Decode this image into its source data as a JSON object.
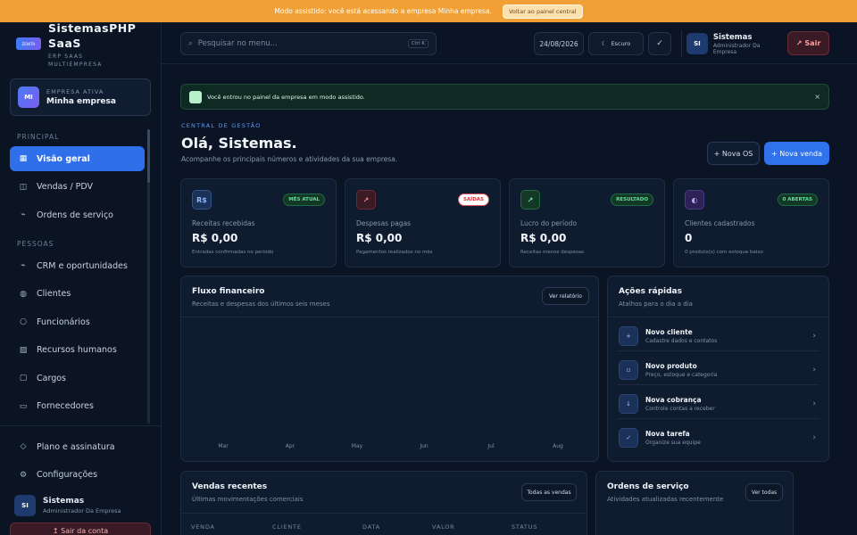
{
  "banner": {
    "text": "Modo assistido: você está acessando a empresa Minha empresa.",
    "button": "Voltar ao painel central"
  },
  "brand": {
    "logo_text": "ZENITH",
    "line1": "SistemasPHP",
    "line2": "SaaS",
    "sub1": "ERP SAAS",
    "sub2": "MULTIEMPRESA"
  },
  "company": {
    "initials": "MI",
    "label": "EMPRESA ATIVA",
    "name": "Minha empresa"
  },
  "sidebar": {
    "section_principal": "PRINCIPAL",
    "section_pessoas": "PESSOAS",
    "items": [
      {
        "label": "Visão geral",
        "icon": "grid-icon"
      },
      {
        "label": "Vendas / PDV",
        "icon": "columns-icon"
      },
      {
        "label": "Ordens de serviço",
        "icon": "wrench-icon"
      },
      {
        "label": "CRM e oportunidades",
        "icon": "trend-icon"
      },
      {
        "label": "Clientes",
        "icon": "users-icon"
      },
      {
        "label": "Funcionários",
        "icon": "user-icon"
      },
      {
        "label": "Recursos humanos",
        "icon": "hr-icon"
      },
      {
        "label": "Cargos",
        "icon": "briefcase-icon"
      },
      {
        "label": "Fornecedores",
        "icon": "truck-icon"
      }
    ],
    "plan": "Plano e assinatura",
    "settings": "Configurações",
    "user": {
      "initials": "SI",
      "name": "Sistemas",
      "role": "Administrador Da Empresa"
    },
    "logout": "Sair da conta"
  },
  "topbar": {
    "search_placeholder": "Pesquisar no menu...",
    "shortcut": "Ctrl K",
    "date": "24/08/2026",
    "theme": "Escuro",
    "user": {
      "initials": "SI",
      "name": "Sistemas",
      "role": "Administrador Da Empresa"
    },
    "logout": "Sair"
  },
  "alert": {
    "text": "Você entrou no painel da empresa em modo assistido.",
    "close": "×"
  },
  "header": {
    "eyebrow": "CENTRAL DE GESTÃO",
    "title": "Olá, Sistemas.",
    "subtitle": "Acompanhe os principais números e atividades da sua empresa.",
    "btn_os": "+ Nova OS",
    "btn_venda": "+ Nova venda"
  },
  "kpis": [
    {
      "icon": "R$",
      "badge": "MÊS ATUAL",
      "label": "Receitas recebidas",
      "value": "R$ 0,00",
      "desc": "Entradas confirmadas no período"
    },
    {
      "icon": "↗",
      "badge": "SAÍDAS",
      "label": "Despesas pagas",
      "value": "R$ 0,00",
      "desc": "Pagamentos realizados no mês"
    },
    {
      "icon": "↗",
      "badge": "RESULTADO",
      "label": "Lucro do período",
      "value": "R$ 0,00",
      "desc": "Receitas menos despesas"
    },
    {
      "icon": "◐",
      "badge": "0 ABERTAS",
      "label": "Clientes cadastrados",
      "value": "0",
      "desc": "0 produto(s) com estoque baixo"
    }
  ],
  "cashflow": {
    "title": "Fluxo financeiro",
    "subtitle": "Receitas e despesas dos últimos seis meses",
    "button": "Ver relatório",
    "months": [
      "Mar",
      "Apr",
      "May",
      "Jun",
      "Jul",
      "Aug"
    ]
  },
  "quick": {
    "title": "Ações rápidas",
    "subtitle": "Atalhos para o dia a dia",
    "items": [
      {
        "icon": "+",
        "title": "Novo cliente",
        "desc": "Cadastre dados e contatos"
      },
      {
        "icon": "▫",
        "title": "Novo produto",
        "desc": "Preço, estoque e categoria"
      },
      {
        "icon": "↓",
        "title": "Nova cobrança",
        "desc": "Controle contas a receber"
      },
      {
        "icon": "✓",
        "title": "Nova tarefa",
        "desc": "Organize sua equipe"
      }
    ]
  },
  "sales": {
    "title": "Vendas recentes",
    "subtitle": "Últimas movimentações comerciais",
    "button": "Todas as vendas",
    "columns": [
      "VENDA",
      "CLIENTE",
      "DATA",
      "VALOR",
      "STATUS"
    ]
  },
  "orders": {
    "title": "Ordens de serviço",
    "subtitle": "Atividades atualizadas recentemente",
    "button": "Ver todas"
  },
  "colors": {
    "accent": "#2f72ec",
    "banner": "#f0a035",
    "bg": "#0b1424",
    "danger": "#e24d5a",
    "success": "#2fbf71"
  }
}
